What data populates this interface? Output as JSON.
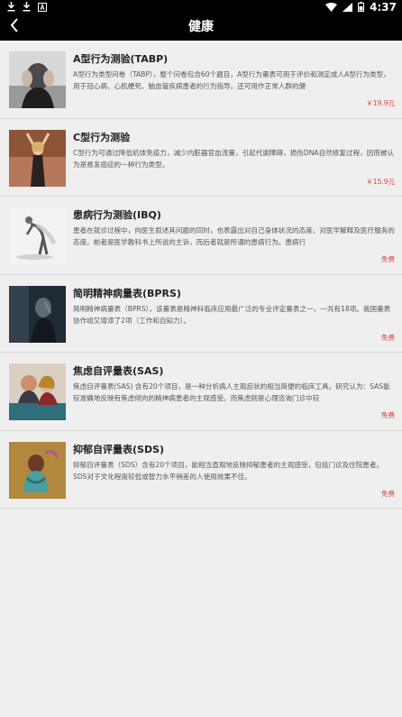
{
  "status_bar": {
    "time": "4:37"
  },
  "header": {
    "title": "健康"
  },
  "items": [
    {
      "title": "A型行为测验(TABP)",
      "description": "A型行为类型问卷（TABP），整个问卷包含60个题目，A型行为量表可用于评价和测定成人A型行为类型，用于冠心病、心肌梗死、脑血管疾病患者的行为指导。还可用作正常人群的健",
      "price": "￥19.9元",
      "thumb_icon": "stressed-man-image"
    },
    {
      "title": "C型行为测验",
      "description": "C型行为可通过降低机体免疫力，减少内脏器官血流量，引起代谢障碍，损伤DNA自然修复过程，因而被认为是易发癌症的一种行为类型。",
      "price": "￥15.9元",
      "thumb_icon": "woman-arms-raised-image"
    },
    {
      "title": "患病行为测验(IBQ)",
      "description": "患者在就诊过程中，向医生叙述其问题的同时，也表露出对自己身体状况的态度、对医学解释及医疗服务的态度。前者是医学教科书上所说的主诉，而后者就是所谓的患病行为。患病行",
      "price": "免费",
      "thumb_icon": "bent-man-figure-image"
    },
    {
      "title": "简明精神病量表(BPRS)",
      "description": "简明精神病量表（BPRS），该量表是精神科临床应用最广泛的专业评定量表之一，一共有18项。我国量表协作组又增添了2项（工作和自知力）。",
      "price": "免费",
      "thumb_icon": "dark-figure-image"
    },
    {
      "title": "焦虑自评量表(SAS)",
      "description": "焦虑自评量表(SAS) 含有20个项目，是一种分析病人主观症状的相当简便的临床工具。研究认为：SAS能较准确地反映有焦虑倾向的精神病患者的主观感受。而焦虑则是心理咨询门诊中较",
      "price": "免费",
      "thumb_icon": "anxious-couple-image"
    },
    {
      "title": "抑郁自评量表(SDS)",
      "description": "抑郁自评量表（SDS）含有20个项目，能相当直观地反映抑郁患者的主观感受，包括门诊及住院患者。SDS对于文化程度较低或智力水平稍差的人使用效果不佳。",
      "price": "免费",
      "thumb_icon": "crouching-child-image"
    }
  ],
  "colors": {
    "bar": "#000000",
    "background": "#efefef",
    "price": "#e53935"
  }
}
